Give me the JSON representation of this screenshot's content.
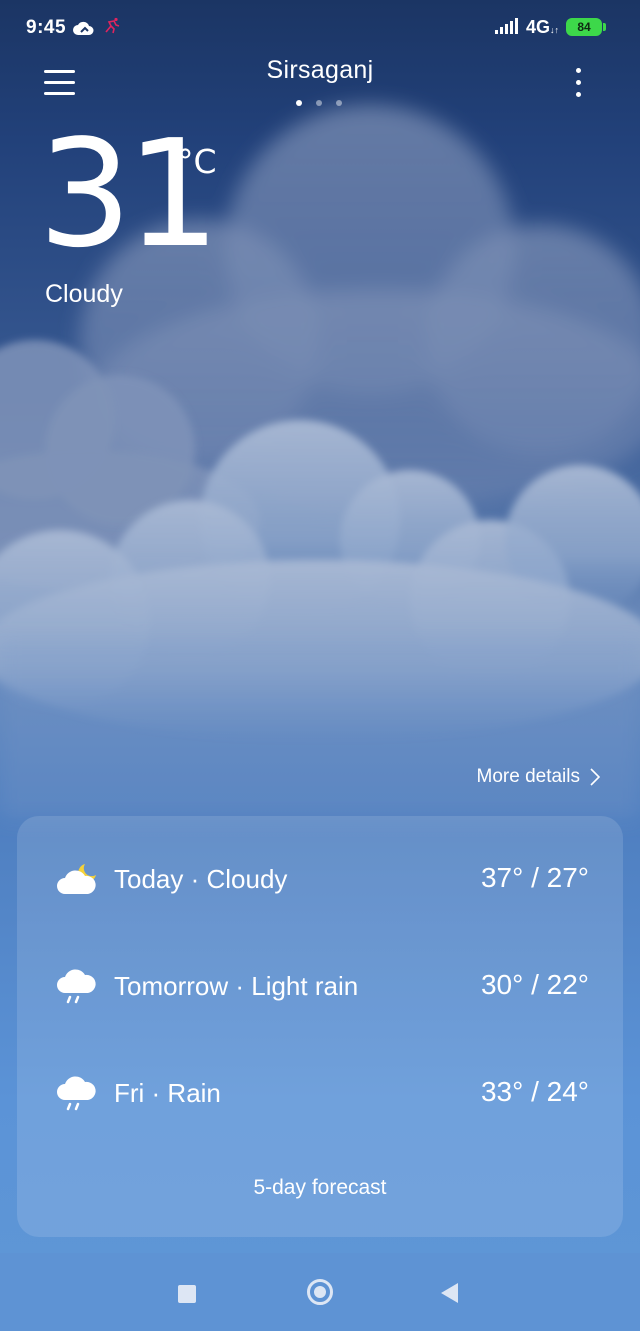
{
  "status_bar": {
    "time": "9:45",
    "network": "4G",
    "network_arrows": "↓↑",
    "battery": "84",
    "icons": [
      "cloud-notification-icon",
      "activity-notification-icon",
      "signal-icon",
      "battery-icon"
    ]
  },
  "header": {
    "city": "Sirsaganj",
    "page_dots": 3,
    "active_dot": 0
  },
  "current": {
    "temperature": "31",
    "unit": "°C",
    "condition": "Cloudy"
  },
  "more_details": {
    "label": "More details"
  },
  "forecast": {
    "rows": [
      {
        "label": "Today · Cloudy",
        "range": "37° / 27°",
        "icon": "cloudy-night-icon"
      },
      {
        "label": "Tomorrow · Light rain",
        "range": "30° / 22°",
        "icon": "light-rain-icon"
      },
      {
        "label": "Fri · Rain",
        "range": "33° / 24°",
        "icon": "rain-icon"
      }
    ],
    "link_label": "5-day forecast"
  },
  "nav_bar": {
    "icons": [
      "recent-apps-icon",
      "home-icon",
      "back-icon"
    ]
  },
  "colors": {
    "bg_top": "#1b3564",
    "bg_bottom": "#5f97d6",
    "battery": "#3dd84a",
    "moon": "#f5d23a"
  }
}
